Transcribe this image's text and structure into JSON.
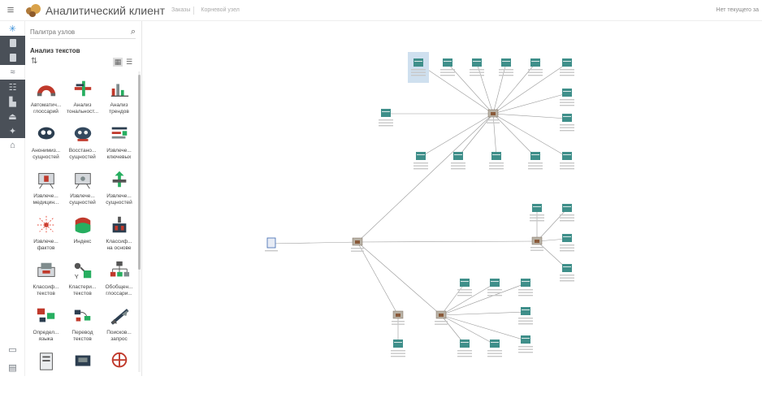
{
  "header": {
    "menu_icon": "hamburger-icon",
    "app_title": "Аналитический клиент",
    "crumbs": [
      "Заказы",
      "Корневой узел"
    ],
    "right_link": "Нет текущего за"
  },
  "rail": {
    "top_icon": "atom-icon",
    "bottom_icons": [
      "book-icon",
      "monitor-icon"
    ]
  },
  "palette": {
    "search_placeholder": "Палитра узлов",
    "group_title": "Анализ текстов",
    "items": [
      {
        "label1": "Автоматич...",
        "label2": "глоссарий",
        "icon": "magnet-icon"
      },
      {
        "label1": "Анализ",
        "label2": "тональност...",
        "icon": "tonality-icon"
      },
      {
        "label1": "Анализ",
        "label2": "трендов",
        "icon": "trends-icon"
      },
      {
        "label1": "Анонимиз...",
        "label2": "сущностей",
        "icon": "mask-icon"
      },
      {
        "label1": "Восстано...",
        "label2": "сущностей",
        "icon": "restore-icon"
      },
      {
        "label1": "Извлече...",
        "label2": "ключевых",
        "icon": "keywords-icon"
      },
      {
        "label1": "Извлече...",
        "label2": "медицин...",
        "icon": "medical-icon"
      },
      {
        "label1": "Извлече...",
        "label2": "сущностей",
        "icon": "entities-icon"
      },
      {
        "label1": "Извлече...",
        "label2": "сущностей",
        "icon": "entities2-icon"
      },
      {
        "label1": "Извлече...",
        "label2": "фактов",
        "icon": "facts-icon"
      },
      {
        "label1": "Индекс",
        "label2": "",
        "icon": "index-icon"
      },
      {
        "label1": "Классиф...",
        "label2": "на основе",
        "icon": "classify-icon"
      },
      {
        "label1": "Классиф...",
        "label2": "текстов",
        "icon": "classify-text-icon"
      },
      {
        "label1": "Кластери...",
        "label2": "текстов",
        "icon": "cluster-icon"
      },
      {
        "label1": "Обобщен...",
        "label2": "глоссари...",
        "icon": "hierarchy-icon"
      },
      {
        "label1": "Определ...",
        "label2": "языка",
        "icon": "language-icon"
      },
      {
        "label1": "Перевод",
        "label2": "текстов",
        "icon": "translate-icon"
      },
      {
        "label1": "Поисков...",
        "label2": "запрос",
        "icon": "search-query-icon"
      },
      {
        "label1": "",
        "label2": "",
        "icon": "doc-icon"
      },
      {
        "label1": "",
        "label2": "",
        "icon": "truck-icon"
      },
      {
        "label1": "",
        "label2": "",
        "icon": "network-icon"
      }
    ]
  },
  "canvas": {
    "source_label": "Исходные данные",
    "hub_label": "Анализ текстов",
    "node_label": "Результаты"
  },
  "colors": {
    "accent": "#3a8fd8",
    "rail_dark": "#4a5058",
    "node_teal": "#3f8f8a",
    "edge": "#999999"
  }
}
